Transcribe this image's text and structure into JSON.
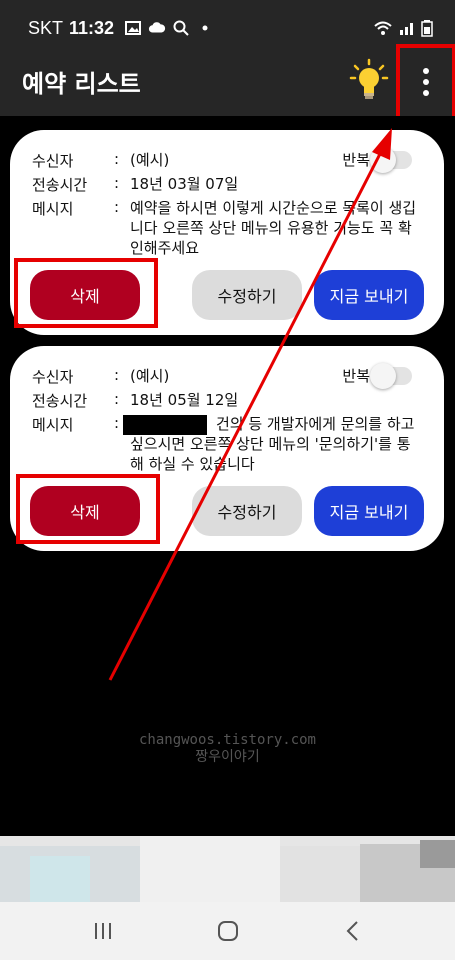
{
  "status": {
    "carrier": "SKT",
    "time": "11:32"
  },
  "app": {
    "title": "예약 리스트"
  },
  "cards": [
    {
      "recipient_label": "수신자",
      "recipient_value": "(예시)",
      "time_label": "전송시간",
      "time_value": "18년 03월 07일",
      "message_label": "메시지",
      "message_value": "예약을 하시면 이렇게 시간순으로 목록이 생깁니다 오른쪽 상단 메뉴의 유용한 기능도 꼭 확인해주세요",
      "repeat_label": "반복",
      "repeat_on": false,
      "delete_label": "삭제",
      "edit_label": "수정하기",
      "send_label": "지금 보내기"
    },
    {
      "recipient_label": "수신자",
      "recipient_value": "(예시)",
      "time_label": "전송시간",
      "time_value": "18년 05월 12일",
      "message_label": "메시지",
      "message_value": "건의 등 개발자에게 문의를 하고 싶으시면 오른쪽 상단 메뉴의 '문의하기'를 통해 하실 수 있습니다",
      "repeat_label": "반복",
      "repeat_on": false,
      "delete_label": "삭제",
      "edit_label": "수정하기",
      "send_label": "지금 보내기"
    }
  ],
  "watermark": {
    "line1": "changwoos.tistory.com",
    "line2": "짱우이야기"
  },
  "colors": {
    "highlight": "#e60000",
    "delete": "#b00020",
    "send": "#1e3fd7",
    "edit": "#dcdcdc",
    "appbar": "#262626"
  },
  "icons": [
    "image-icon",
    "cloud-icon",
    "search-icon",
    "dot-icon",
    "wifi-icon",
    "signal-icon",
    "battery-icon",
    "lightbulb-icon",
    "more-vert-icon",
    "recent-apps-icon",
    "home-icon",
    "back-icon"
  ]
}
